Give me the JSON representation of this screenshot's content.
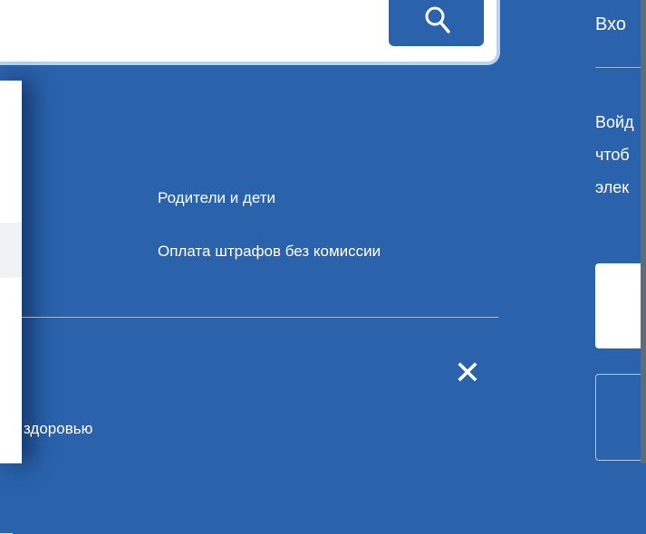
{
  "search": {
    "button_icon": "search-icon"
  },
  "menu": {
    "links": [
      "Родители и дети",
      "Оплата штрафов без комиссии"
    ],
    "partial_link": "здоровью",
    "close_icon": "close-icon",
    "close_glyph": "✕"
  },
  "login": {
    "title": "Вхо",
    "text_lines": [
      "Войд",
      "чтоб",
      "элек"
    ]
  },
  "colors": {
    "background": "#2a62ab",
    "panel": "#ffffff",
    "search_button": "#2a62ab"
  }
}
